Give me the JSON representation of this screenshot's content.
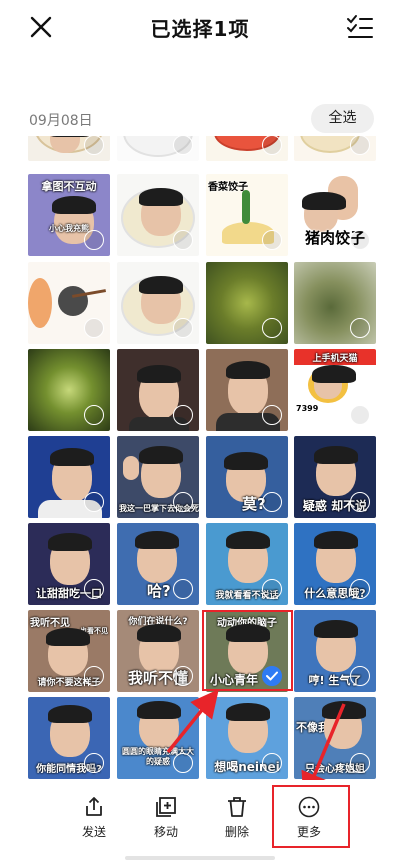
{
  "header": {
    "title": "已选择1项",
    "close_icon": "close-icon",
    "select_mode_icon": "checklist-icon"
  },
  "section": {
    "date": "09月08日",
    "select_all": "全选"
  },
  "grid": {
    "captions": {
      "r1c1_title": "拿图不互动",
      "r1c1_sub": "小心我充熊",
      "r1c3_title": "香菜饺子",
      "r1c4": "猪肉饺子",
      "r3c4_title": "上手机天猫",
      "r3c4_sub": "7399",
      "r4c2": "我这一巴掌下去你会死",
      "r4c3": "莫?",
      "r4c4": "疑惑 却不说",
      "r5c1": "让甜甜吃一口",
      "r5c2": "哈?",
      "r5c3": "我就看看不说话",
      "r5c4": "什么意思哦?",
      "r6c1_top": "我听不见",
      "r6c1_top2": "也看不见",
      "r6c1": "请你不要这样子",
      "r6c2_top": "你们在说什么?",
      "r6c2": "我听不懂",
      "r6c3_top": "动动你的脑子",
      "r6c3": "小心青年",
      "r6c4": "哼! 生气了",
      "r7c1": "你能同情我吗?",
      "r7c2": "圆圆的眼睛充满大大的疑惑",
      "r7c3": "想喝neinei",
      "r7c4_top": "不像我",
      "r7c4": "只会心疼姐姐"
    },
    "selected_count": 1
  },
  "toolbar": {
    "send": "发送",
    "move": "移动",
    "delete": "删除",
    "more": "更多"
  },
  "colors": {
    "accent": "#2f7bf4",
    "highlight": "#e8242a"
  }
}
